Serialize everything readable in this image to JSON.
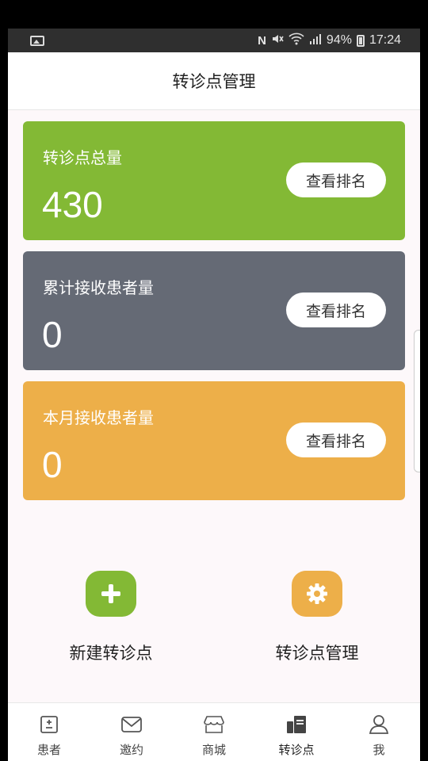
{
  "status_bar": {
    "battery": "94%",
    "time": "17:24"
  },
  "header": {
    "title": "转诊点管理"
  },
  "cards": [
    {
      "label": "转诊点总量",
      "value": "430",
      "button": "查看排名",
      "color": "#83b935"
    },
    {
      "label": "累计接收患者量",
      "value": "0",
      "button": "查看排名",
      "color": "#656a75"
    },
    {
      "label": "本月接收患者量",
      "value": "0",
      "button": "查看排名",
      "color": "#edaf49"
    }
  ],
  "actions": {
    "new_point": {
      "label": "新建转诊点",
      "icon": "plus-icon",
      "color": "#83b935"
    },
    "manage_point": {
      "label": "转诊点管理",
      "icon": "gear-icon",
      "color": "#edaf49"
    }
  },
  "tabbar": {
    "items": [
      {
        "label": "患者",
        "icon": "patient-icon"
      },
      {
        "label": "邀约",
        "icon": "mail-icon"
      },
      {
        "label": "商城",
        "icon": "store-icon"
      },
      {
        "label": "转诊点",
        "icon": "referral-icon",
        "active": true
      },
      {
        "label": "我",
        "icon": "user-icon"
      }
    ]
  }
}
